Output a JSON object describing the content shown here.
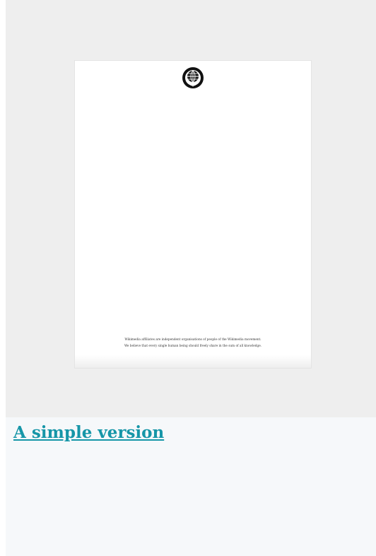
{
  "page": {
    "background": "#ffffff"
  },
  "preview": {
    "background": "#eeeeee",
    "document": {
      "background": "#ffffff",
      "logo_icon": "wikimedia-globe-logo-icon",
      "footer_lines": [
        "Wikimedia affiliates are independent organisations of people of the Wikimedia movement.",
        "We believe that every single human being should freely share in the sum of all knowledge."
      ]
    }
  },
  "section": {
    "background": "#f6f8fa",
    "link_text": "A simple version",
    "link_color": "#1696a8"
  }
}
